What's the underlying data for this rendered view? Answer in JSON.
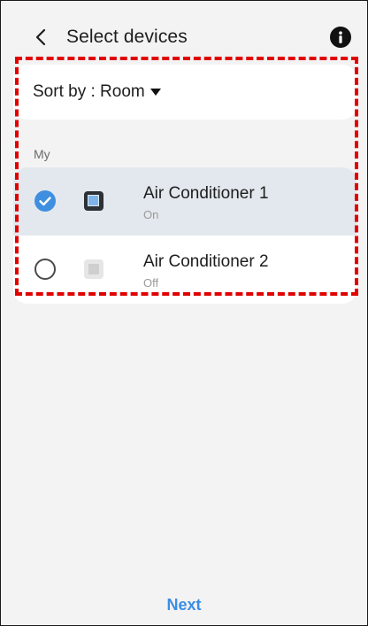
{
  "header": {
    "title": "Select devices",
    "back_icon": "chevron-left-icon",
    "info_icon": "info-icon"
  },
  "sort": {
    "label": "Sort by : Room",
    "caret_icon": "caret-down-icon"
  },
  "section": {
    "label": "My"
  },
  "devices": [
    {
      "name": "Air Conditioner 1",
      "status": "On",
      "selected": true,
      "icon": "air-conditioner-icon"
    },
    {
      "name": "Air Conditioner 2",
      "status": "Off",
      "selected": false,
      "icon": "air-conditioner-icon"
    }
  ],
  "footer": {
    "next_label": "Next"
  },
  "colors": {
    "accent": "#3a8ee6",
    "selected_row": "#e3e8ee",
    "background": "#f3f3f3",
    "highlight": "#e00000"
  }
}
